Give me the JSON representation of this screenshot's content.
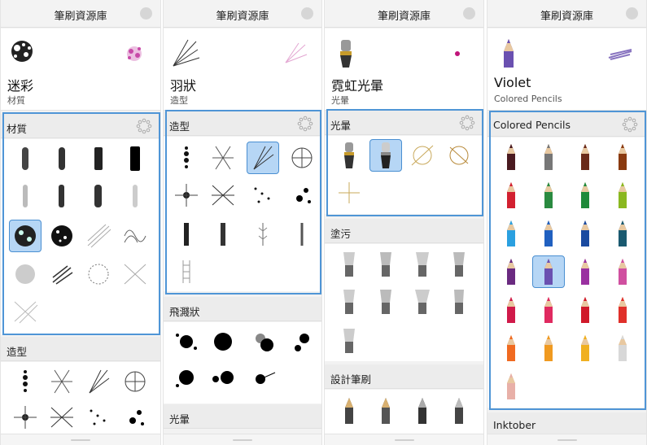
{
  "panels": [
    {
      "title": "筆刷資源庫",
      "preview": {
        "name": "迷彩",
        "category": "材質",
        "stroke_color": "#c84aa8"
      },
      "sections": [
        {
          "title": "材質",
          "highlighted": true,
          "selected_index": 8,
          "items": [
            "stroke-a",
            "stroke-b",
            "stroke-c",
            "stroke-d",
            "stroke-e",
            "stroke-f",
            "stroke-g",
            "stroke-h",
            "camo",
            "splat-dense",
            "hatch-fine",
            "scribble",
            "grain",
            "hatch-bold",
            "scratch",
            "crosshatch"
          ]
        },
        {
          "title": "造型",
          "highlighted": false,
          "selected_index": -1,
          "items": [
            "dotline",
            "mesh",
            "feather",
            "web",
            "burst",
            "starburst",
            "dots",
            "splotch"
          ]
        }
      ]
    },
    {
      "title": "筆刷資源庫",
      "preview": {
        "name": "羽狀",
        "category": "造型",
        "stroke_color": "#d06ab4"
      },
      "sections": [
        {
          "title": "造型",
          "highlighted": true,
          "selected_index": 2,
          "items": [
            "dotline",
            "mesh",
            "feather",
            "web",
            "burst",
            "starburst",
            "dots",
            "splotch",
            "spike",
            "spike2",
            "fern",
            "wisp",
            "ladder"
          ]
        },
        {
          "title": "飛濺狀",
          "highlighted": false,
          "selected_index": -1,
          "items": [
            "splat1",
            "splat2",
            "splat3",
            "splat4",
            "splat5",
            "splat6",
            "splat7"
          ]
        },
        {
          "title": "光暈",
          "highlighted": false,
          "selected_index": -1,
          "items": []
        }
      ]
    },
    {
      "title": "筆刷資源庫",
      "preview": {
        "name": "霓虹光暈",
        "category": "光暈",
        "stroke_color": "#c0147a"
      },
      "sections": [
        {
          "title": "光暈",
          "highlighted": true,
          "selected_index": 1,
          "items": [
            "brush-gold",
            "brush-blue",
            "glow-ring",
            "glow-star",
            "glow-spark"
          ]
        },
        {
          "title": "塗污",
          "highlighted": false,
          "selected_index": -1,
          "items": [
            "smudge1",
            "smudge2",
            "smudge3",
            "smudge4",
            "smudge5",
            "smudge6",
            "smudge7",
            "smudge8",
            "smudge9"
          ]
        },
        {
          "title": "設計筆刷",
          "highlighted": false,
          "selected_index": -1,
          "items": [
            "pen1",
            "pen2",
            "pen3",
            "pen4"
          ]
        }
      ]
    },
    {
      "title": "筆刷資源庫",
      "preview": {
        "name": "Violet",
        "category": "Colored Pencils",
        "stroke_color": "#6a50b0"
      },
      "sections": [
        {
          "title": "Colored Pencils",
          "highlighted": true,
          "selected_index": 13,
          "pencil_colors": [
            "#4a1a20",
            "#777777",
            "#6a2a1a",
            "#8a3a10",
            "#d22030",
            "#2a8a40",
            "#1f8a3a",
            "#8ab820",
            "#2aa0e0",
            "#2060c0",
            "#1a4aa0",
            "#1a5a70",
            "#6a2a80",
            "#6a50b0",
            "#9a30a0",
            "#d050a0",
            "#d01a4a",
            "#e02a60",
            "#d01a2a",
            "#e0302a",
            "#f06a20",
            "#f09a20",
            "#f0b020",
            "#d8d8d8",
            "#e8b0a8"
          ]
        },
        {
          "title": "Inktober",
          "highlighted": false,
          "selected_index": -1
        }
      ]
    }
  ]
}
